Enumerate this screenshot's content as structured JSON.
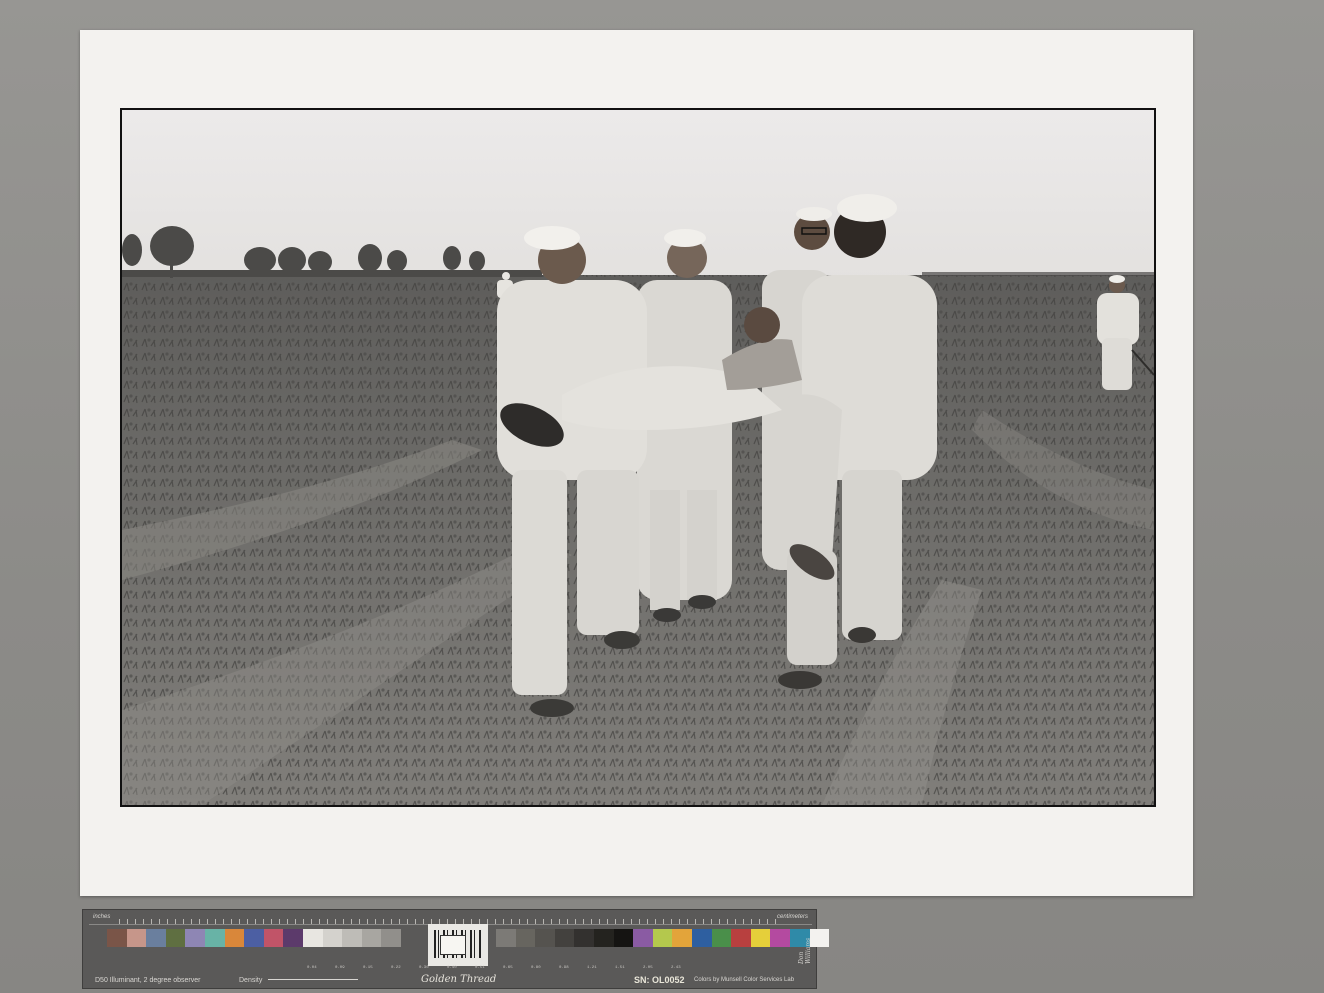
{
  "photo": {
    "subject": "",
    "colors": {
      "sky": "#ebe9e8",
      "ground": "#6e6d6b",
      "white_uniform": "#d9d7d2"
    }
  },
  "color_target": {
    "ruler_left_unit": "inches",
    "ruler_right_unit": "centimeters",
    "illuminant": "D50 Illuminant, 2 degree observer",
    "density_label": "Density",
    "brand": "Golden Thread",
    "serial": "SN: OL0052",
    "credit": "Colors by Munsell Color Services Lab",
    "signature": "Don Williams",
    "patches_left": [
      "#7a5548",
      "#c6968a",
      "#6a7f9e",
      "#5f6f41",
      "#8e86b4",
      "#68b3a6",
      "#d9873a",
      "#4c5fa3",
      "#c15468",
      "#5c3a6b",
      "#e8e6e1",
      "#d4d2cd",
      "#bebcb7",
      "#a8a6a1",
      "#918f8b"
    ],
    "patches_right": [
      "#7c7a76",
      "#67655f",
      "#55534f",
      "#43413e",
      "#33312f",
      "#24231f",
      "#151412",
      "#8a5ba3",
      "#b4c84d",
      "#e3a43a",
      "#2e5fa0",
      "#4a8f4a",
      "#b8403f",
      "#e5cf3a",
      "#b44aa0",
      "#2f8aa8",
      "#f3f2ef"
    ],
    "density_values": [
      "0.04",
      "0.09",
      "0.15",
      "0.22",
      "0.30",
      "0.40",
      "0.51",
      "0.65",
      "0.80",
      "0.98",
      "1.21",
      "1.51",
      "2.05",
      "2.43"
    ]
  }
}
